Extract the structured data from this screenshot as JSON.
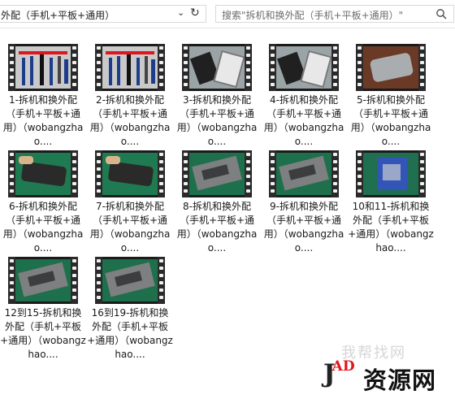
{
  "address_bar": {
    "path": "外配（手机+平板+通用）"
  },
  "search": {
    "placeholder": "搜索\"拆机和换外配（手机+平板+通用）\""
  },
  "files": [
    {
      "label": "1-拆机和换外配（手机+平板+通用）（wobangzhao....",
      "thumb": "tools"
    },
    {
      "label": "2-拆机和换外配（手机+平板+通用）（wobangzhao....",
      "thumb": "tools"
    },
    {
      "label": "3-拆机和换外配（手机+平板+通用）（wobangzhao....",
      "thumb": "phones"
    },
    {
      "label": "4-拆机和换外配（手机+平板+通用）（wobangzhao....",
      "thumb": "phones"
    },
    {
      "label": "5-拆机和换外配（手机+平板+通用）（wobangzhao....",
      "thumb": "silver"
    },
    {
      "label": "6-拆机和换外配（手机+平板+通用）（wobangzhao....",
      "thumb": "green"
    },
    {
      "label": "7-拆机和换外配（手机+平板+通用）（wobangzhao....",
      "thumb": "green"
    },
    {
      "label": "8-拆机和换外配（手机+平板+通用）（wobangzhao....",
      "thumb": "board"
    },
    {
      "label": "9-拆机和换外配（手机+平板+通用）（wobangzhao....",
      "thumb": "board"
    },
    {
      "label": "10和11-拆机和换外配（手机+平板+通用）（wobangzhao....",
      "thumb": "blue"
    },
    {
      "label": "12到15-拆机和换外配（手机+平板+通用）（wobangzhao....",
      "thumb": "board"
    },
    {
      "label": "16到19-拆机和换外配（手机+平板+通用）（wobangzhao....",
      "thumb": "board"
    }
  ],
  "watermark": {
    "faded": "我帮找网",
    "logo_j": "J",
    "logo_ad": "AD",
    "brand": "资源网"
  }
}
